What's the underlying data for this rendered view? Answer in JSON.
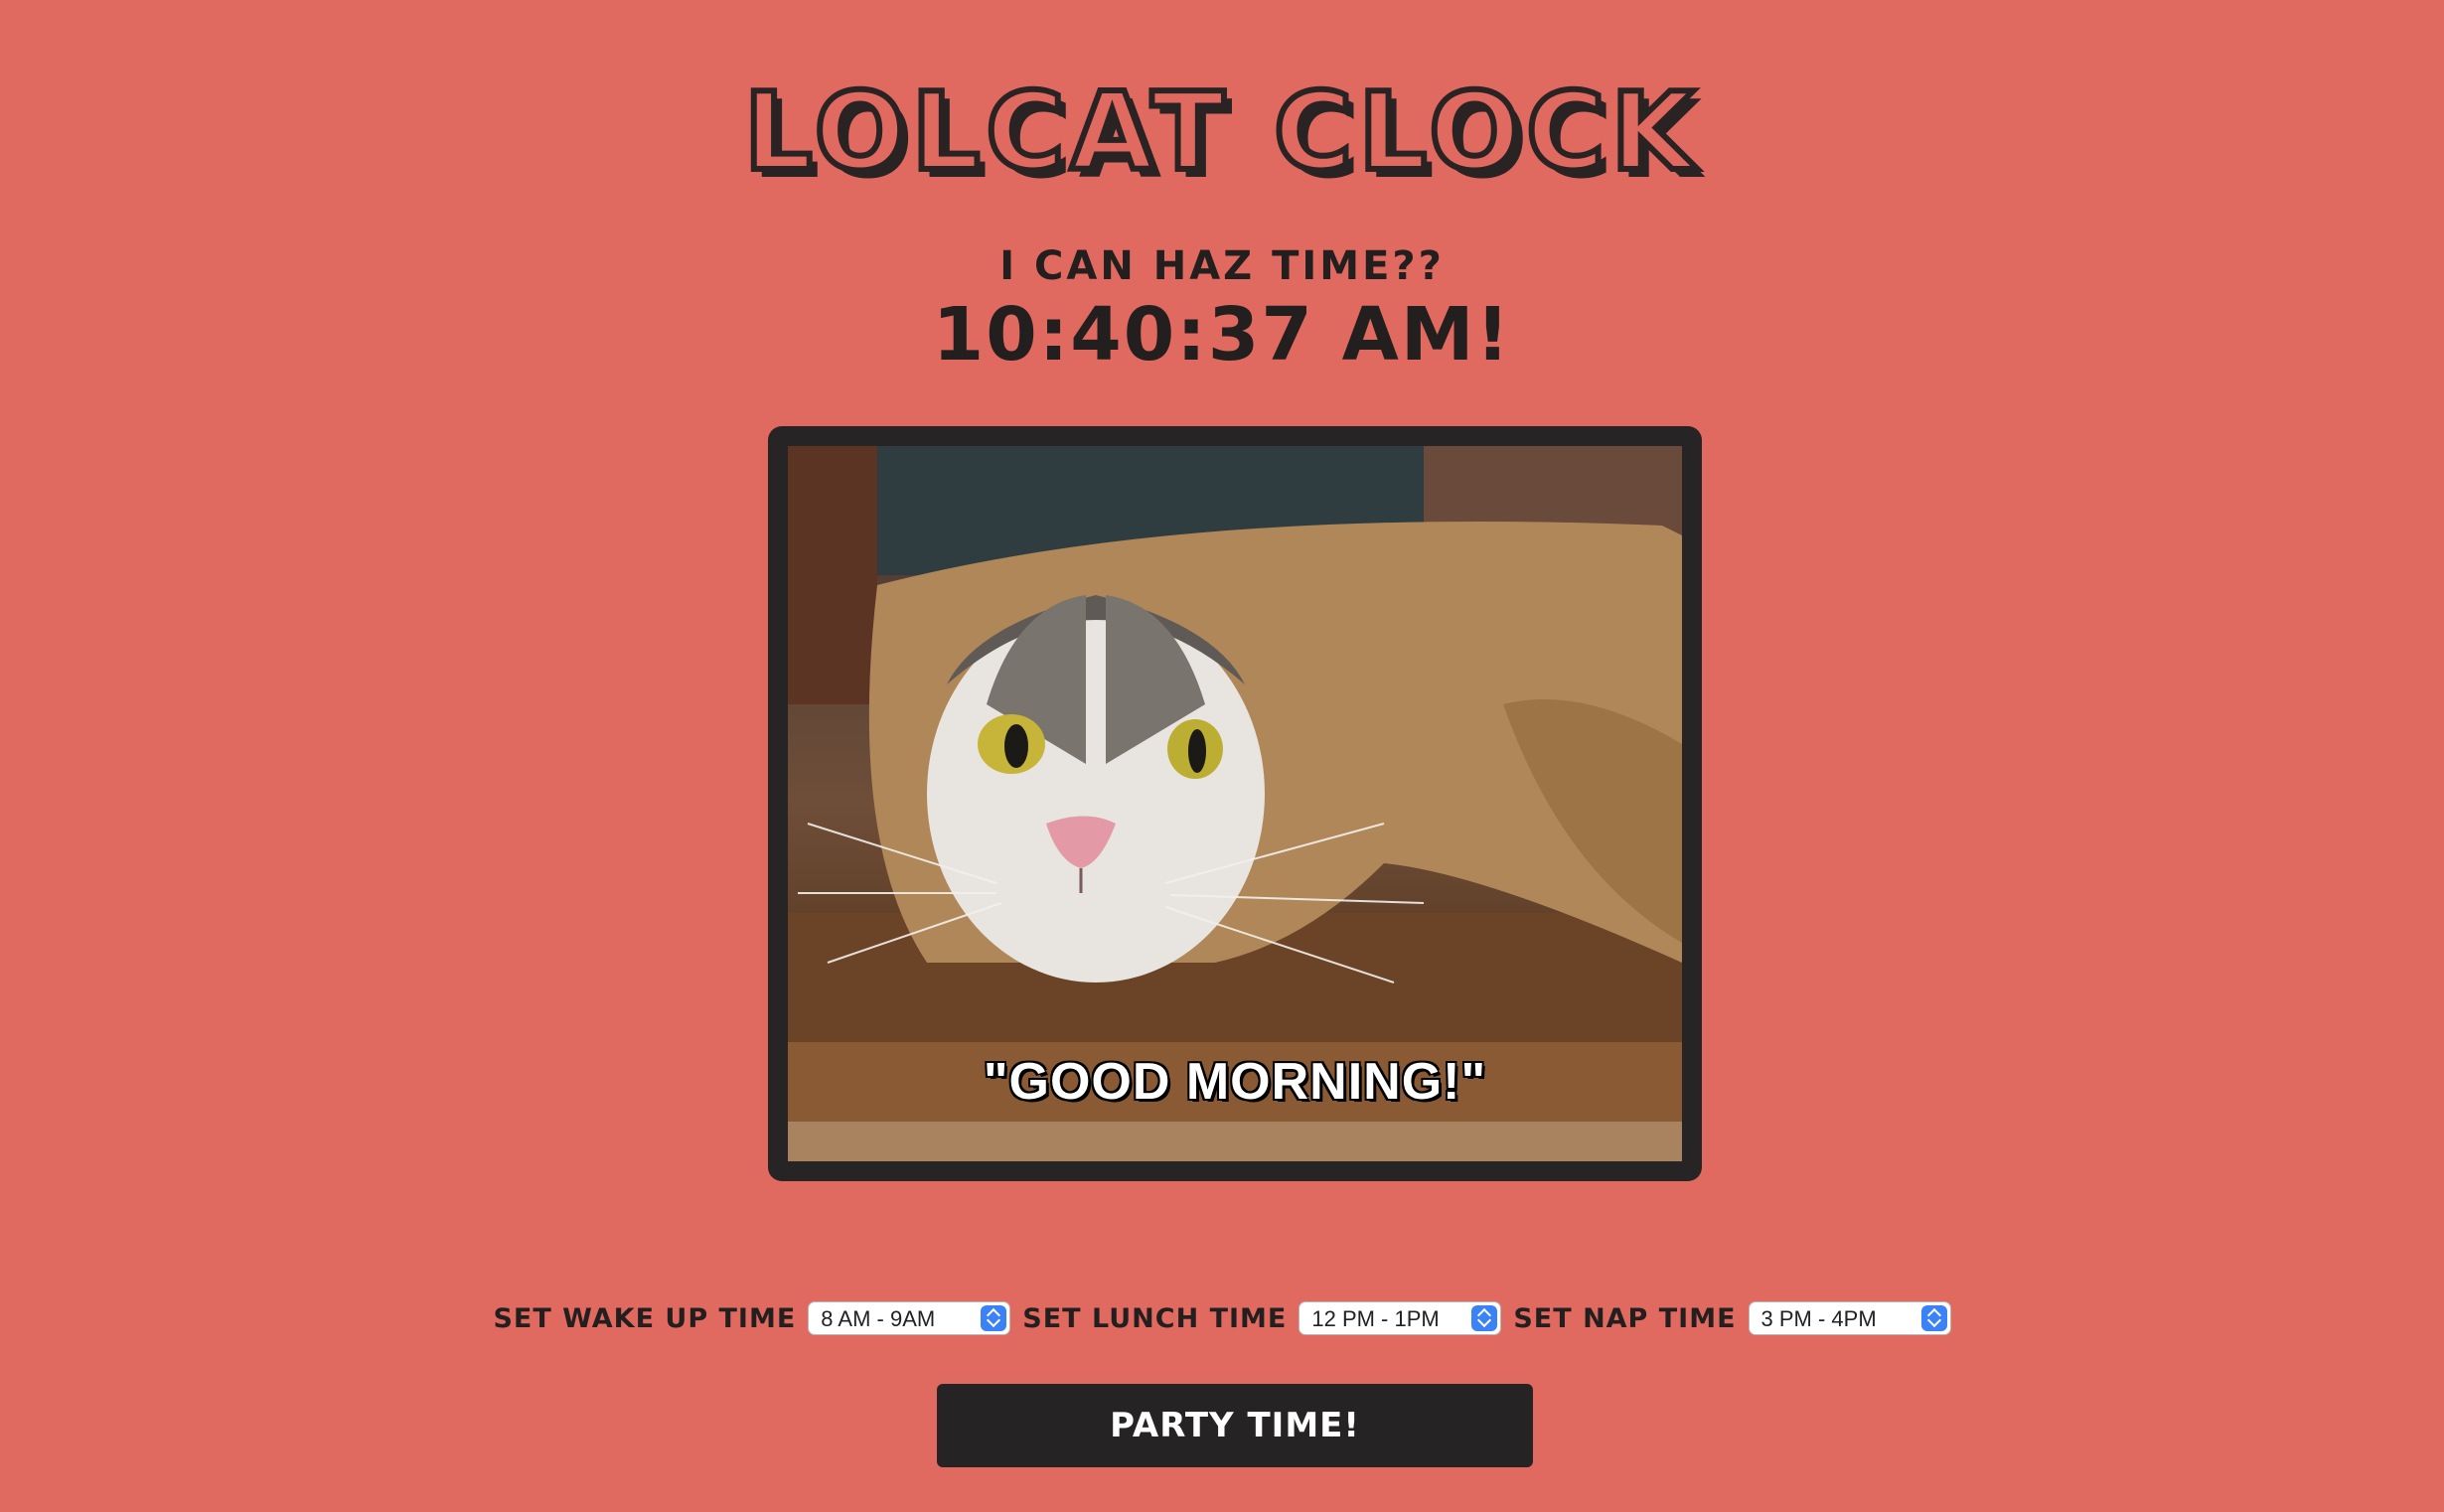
{
  "header": {
    "title": "LOLCAT CLOCK",
    "subtitle": "I CAN HAZ TIME??",
    "clock_text": "10:40:37 AM!"
  },
  "image": {
    "caption": "\"GOOD MORNING!\"",
    "icon": "lolcat-photo"
  },
  "controls": {
    "wake_label": "SET WAKE UP TIME",
    "wake_value": "8 AM - 9AM",
    "lunch_label": "SET LUNCH TIME",
    "lunch_value": "12 PM - 1PM",
    "nap_label": "SET NAP TIME",
    "nap_value": "3 PM - 4PM"
  },
  "party_button": {
    "label": "PARTY TIME!"
  },
  "colors": {
    "background": "#e06960",
    "dark": "#231f1f",
    "select_arrow": "#3b82f6"
  }
}
